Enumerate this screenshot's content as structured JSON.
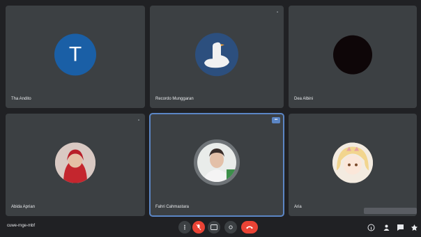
{
  "participants": [
    {
      "name": "Tha Andito",
      "avatar": "letter-avatar",
      "initial": "T",
      "corner": ""
    },
    {
      "name": "Recordo Munggaran",
      "avatar": "goose-avatar",
      "corner": "▪"
    },
    {
      "name": "Dea Albini",
      "avatar": "black-circle-avatar",
      "corner": ""
    },
    {
      "name": "Abida Aprian",
      "avatar": "hijab-photo-avatar",
      "corner": "▪"
    },
    {
      "name": "Fahri Cahmastara",
      "avatar": "man-photo-avatar",
      "corner": "▪▪"
    },
    {
      "name": "Aria",
      "avatar": "anime-avatar",
      "corner": ""
    }
  ],
  "bottom_bar": {
    "meeting_code": "cuwe-rnge-mbf",
    "controls": [
      "more-options-icon",
      "mic-off-icon",
      "captions-icon",
      "present-icon",
      "hang-up-icon"
    ],
    "right_icons": [
      "info-icon",
      "people-icon",
      "chat-icon",
      "activities-icon"
    ]
  },
  "colors": {
    "background": "#202124",
    "tile": "#3c4043",
    "active_outline": "#5b86c5",
    "mute_red": "#ea4335"
  }
}
